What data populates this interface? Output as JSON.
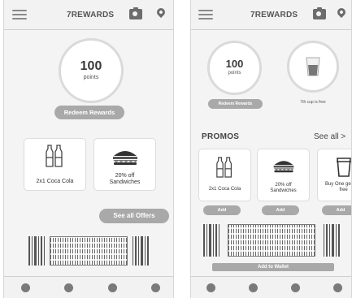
{
  "app": {
    "title": "7REWARDS"
  },
  "icons": {
    "menu": "hamburger-icon",
    "camera": "camera-icon",
    "location": "location-pin-icon"
  },
  "screen1": {
    "points": {
      "value": "100",
      "label": "points"
    },
    "redeem_label": "Redeem Rewards",
    "offers": [
      {
        "label": "2x1 Coca Cola",
        "icon": "soda-bottles-icon"
      },
      {
        "label": "20% off Sandwiches",
        "icon": "sandwich-icon"
      }
    ],
    "see_all_label": "See all Offers"
  },
  "screen2": {
    "points": {
      "value": "100",
      "label": "points"
    },
    "redeem_label": "Redeem Rewards",
    "cup_caption": "7th cup is free",
    "promos_title": "PROMOS",
    "see_all_label": "See all >",
    "promos": [
      {
        "label": "2x1 Coca Cola",
        "icon": "soda-bottles-icon",
        "button": "Add"
      },
      {
        "label": "20% off Sandwiches",
        "icon": "sandwich-icon",
        "button": "Add"
      },
      {
        "label": "Buy One get one free",
        "icon": "cup-icon",
        "button": "Add"
      }
    ],
    "wallet_label": "Add to Wallet"
  },
  "colors": {
    "pill": "#a9a9a9",
    "icon": "#6c6c6c",
    "background": "#f4f4f4"
  }
}
